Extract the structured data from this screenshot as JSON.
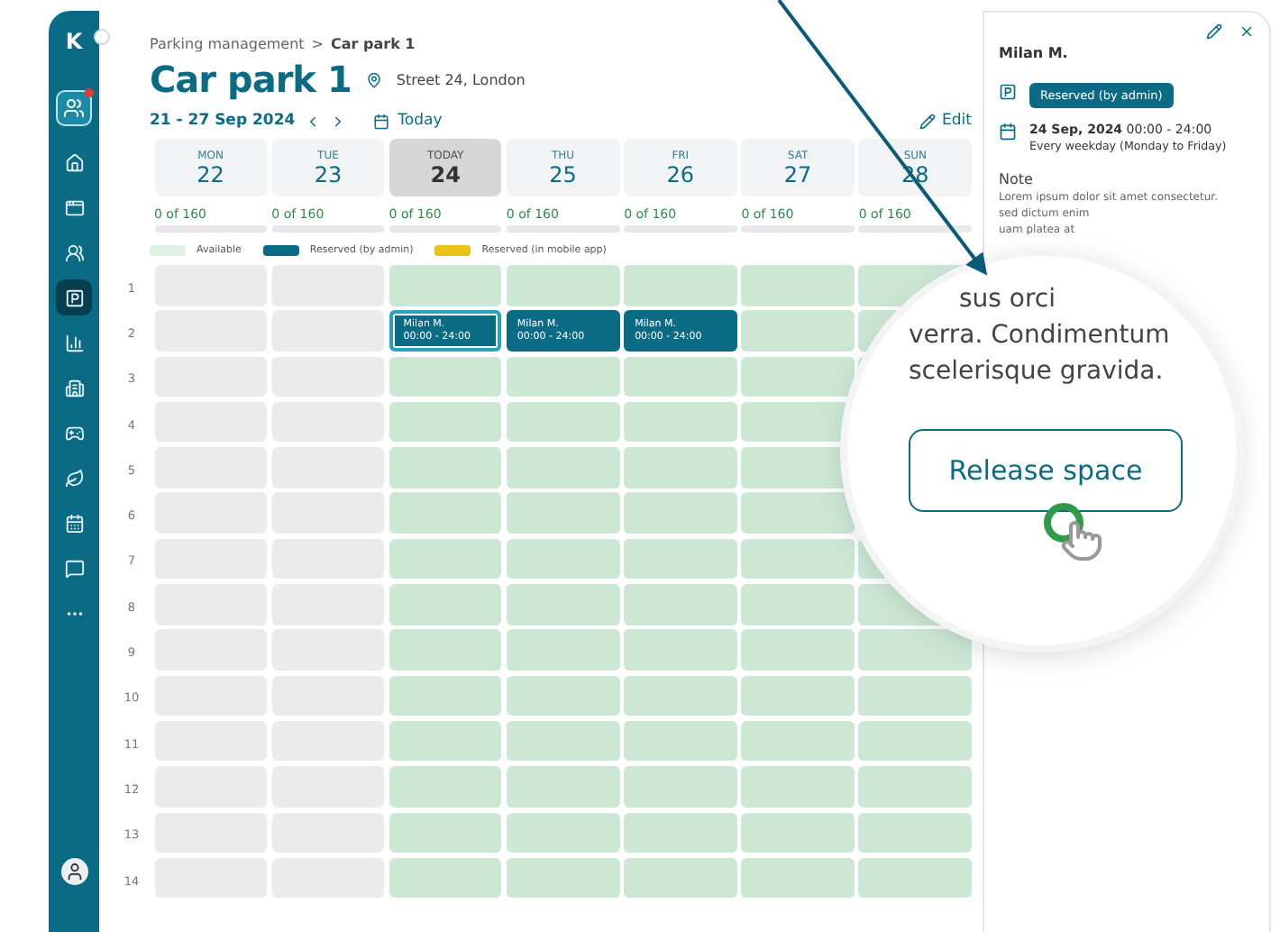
{
  "sidebar": {
    "logo": "K",
    "workspace": {
      "notification": true
    },
    "items": [
      {
        "selected": false
      },
      {
        "selected": false
      },
      {
        "selected": false
      },
      {
        "selected": true
      },
      {
        "selected": false
      },
      {
        "selected": false
      },
      {
        "selected": false
      },
      {
        "selected": false
      },
      {
        "selected": false
      },
      {
        "selected": false
      },
      {
        "selected": false
      }
    ]
  },
  "breadcrumb": {
    "parent": "Parking management",
    "separator": ">",
    "current": "Car park 1"
  },
  "title": "Car park 1",
  "location": "Street 24, London",
  "week": {
    "range": "21 - 27 Sep 2024",
    "today": "Today",
    "edit": "Edit"
  },
  "days": [
    {
      "weekday": "MON",
      "date": "22",
      "selected": false,
      "past": true,
      "occupancy": "0 of 160",
      "level": 0
    },
    {
      "weekday": "TUE",
      "date": "23",
      "selected": false,
      "past": true,
      "occupancy": "0 of 160",
      "level": 0
    },
    {
      "weekday": "TODAY",
      "date": "24",
      "selected": true,
      "past": false,
      "occupancy": "0 of 160",
      "level": 0
    },
    {
      "weekday": "THU",
      "date": "25",
      "selected": false,
      "past": false,
      "occupancy": "0 of 160",
      "level": 0
    },
    {
      "weekday": "FRI",
      "date": "26",
      "selected": false,
      "past": false,
      "occupancy": "0 of 160",
      "level": 0
    },
    {
      "weekday": "SAT",
      "date": "27",
      "selected": false,
      "past": false,
      "occupancy": "0 of 160",
      "level": 0
    },
    {
      "weekday": "SUN",
      "date": "28",
      "selected": false,
      "past": false,
      "occupancy": "0 of 160",
      "level": 0
    }
  ],
  "legend": [
    {
      "label": "Available",
      "color": "#e2f1e6"
    },
    {
      "label": "Reserved (by admin)",
      "color": "#0b6b85"
    },
    {
      "label": "Reserved (in mobile app)",
      "color": "#e9c21a"
    }
  ],
  "rows": [
    {
      "number": "1"
    },
    {
      "number": "2",
      "cells": [
        {
          "kind": "empty"
        },
        {
          "kind": "empty"
        },
        {
          "kind": "booking",
          "name": "Milan M.",
          "time": "00:00 - 24:00",
          "selected": true
        },
        {
          "kind": "booking",
          "name": "Milan M.",
          "time": "00:00 - 24:00",
          "selected": false
        },
        {
          "kind": "booking",
          "name": "Milan M.",
          "time": "00:00 - 24:00",
          "selected": false
        },
        {
          "kind": "empty"
        },
        {
          "kind": "empty"
        }
      ]
    },
    {
      "number": "3"
    },
    {
      "number": "4"
    },
    {
      "number": "5"
    },
    {
      "number": "6"
    },
    {
      "number": "7"
    },
    {
      "number": "8"
    },
    {
      "number": "9"
    },
    {
      "number": "10"
    },
    {
      "number": "11"
    },
    {
      "number": "12"
    },
    {
      "number": "13"
    },
    {
      "number": "14"
    }
  ],
  "panel": {
    "name": "Milan M.",
    "status": "Reserved (by admin)",
    "date": "24 Sep, 2024",
    "time": "00:00 - 24:00",
    "recurrence": "Every weekday (Monday to Friday)",
    "note_label": "Note",
    "note_lines": [
      "Lorem ipsum dolor sit amet consectetur.",
      "sed dictum enim",
      "uam platea at"
    ]
  },
  "magnifier": {
    "lines": [
      "sus orci",
      "verra. Condimentum",
      "scelerisque gravida."
    ],
    "button": "Release space"
  }
}
